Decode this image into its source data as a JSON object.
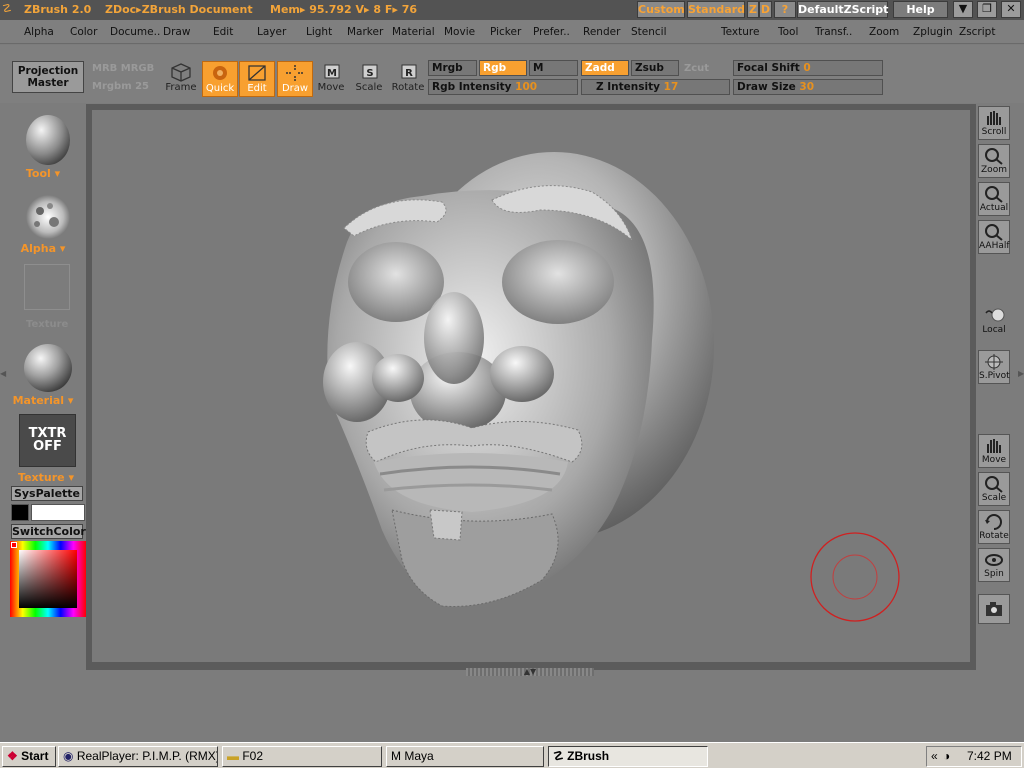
{
  "titlebar": {
    "app": "ZBrush 2.0",
    "doc": "ZDoc▸ZBrush Document",
    "mem": "Mem▸ 95.792  V▸ 8  F▸ 76",
    "custom": "Custom",
    "standard": "Standard",
    "z": "Z",
    "d": "D",
    "q": "?",
    "zscript": "DefaultZScript",
    "help": "Help"
  },
  "menu": [
    "Alpha",
    "Color",
    "Docume..",
    "Draw",
    "Edit",
    "Layer",
    "Light",
    "Marker",
    "Material",
    "Movie",
    "Picker",
    "Prefer..",
    "Render",
    "Stencil",
    "Texture",
    "Tool",
    "Transf..",
    "Zoom",
    "Zplugin",
    "Zscript"
  ],
  "toolbar": {
    "projection_master": [
      "Projection",
      "Master"
    ],
    "faded1": "MRB  MRGB",
    "faded2": "Mrgbm 25",
    "tools": [
      "Frame",
      "Quick",
      "Edit",
      "Draw",
      "Move",
      "Scale",
      "Rotate"
    ],
    "mrgb": "Mrgb",
    "rgb": "Rgb",
    "m": "M",
    "zadd": "Zadd",
    "zsub": "Zsub",
    "zcut": "Zcut",
    "rgb_intensity_label": "Rgb  Intensity",
    "rgb_intensity_value": "100",
    "z_intensity_label": "Z  Intensity",
    "z_intensity_value": "17",
    "focal_shift_label": "Focal  Shift",
    "focal_shift_value": "0",
    "draw_size_label": "Draw  Size",
    "draw_size_value": "30"
  },
  "left": {
    "tool": "Tool",
    "alpha": "Alpha",
    "faded": "Texture",
    "material": "Material",
    "txtr": [
      "TXTR",
      "OFF"
    ],
    "texture": "Texture",
    "syspalette": "SysPalette",
    "switchcolor": "SwitchColor"
  },
  "right": [
    "Scroll",
    "Zoom",
    "Actual",
    "AAHalf",
    "Local",
    "S.Pivot",
    "Move",
    "Scale",
    "Rotate",
    "Spin"
  ],
  "taskbar": {
    "start": "Start",
    "tasks": [
      "RealPlayer: P.I.M.P. (RMX)",
      "F02",
      "Maya",
      "ZBrush"
    ],
    "time": "7:42 PM"
  },
  "colors": {
    "accent": "#f8a030",
    "brush_ring": "#d02020"
  }
}
